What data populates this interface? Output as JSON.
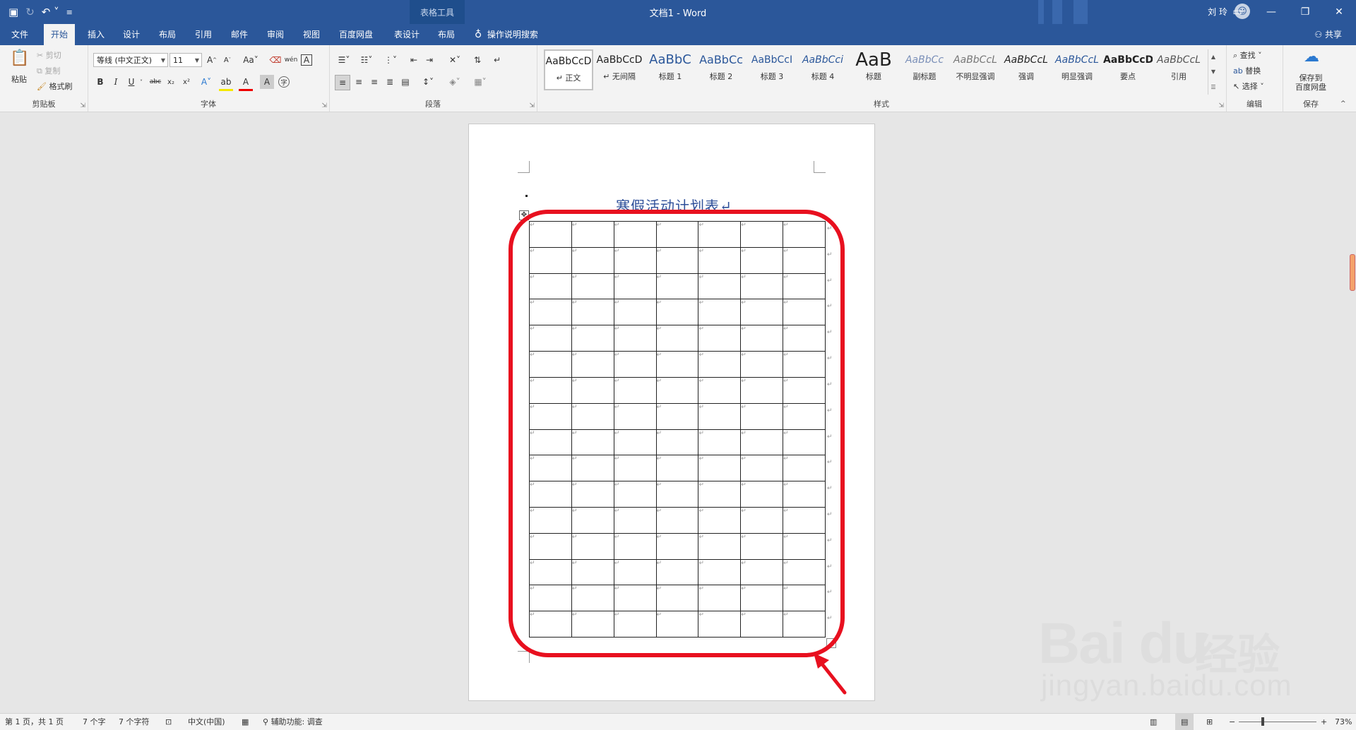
{
  "titlebar": {
    "doc_title": "文档1  -  Word",
    "context_tab": "表格工具",
    "user_name": "刘 玲",
    "qat": [
      "save-icon",
      "redo-icon",
      "undo-icon",
      "customize-icon"
    ]
  },
  "tabs": [
    {
      "label": "文件"
    },
    {
      "label": "开始"
    },
    {
      "label": "插入"
    },
    {
      "label": "设计"
    },
    {
      "label": "布局"
    },
    {
      "label": "引用"
    },
    {
      "label": "邮件"
    },
    {
      "label": "审阅"
    },
    {
      "label": "视图"
    },
    {
      "label": "百度网盘"
    },
    {
      "label": "表设计"
    },
    {
      "label": "布局"
    }
  ],
  "tell_me": "操作说明搜索",
  "share": "共享",
  "ribbon": {
    "clipboard": {
      "paste": "粘贴",
      "cut": "剪切",
      "copy": "复制",
      "format_painter": "格式刷",
      "label": "剪贴板"
    },
    "font": {
      "font_name": "等线 (中文正文)",
      "font_size": "11",
      "label": "字体"
    },
    "paragraph": {
      "label": "段落"
    },
    "styles": {
      "label": "样式",
      "items": [
        {
          "preview": "AaBbCcD",
          "name": "↵ 正文"
        },
        {
          "preview": "AaBbCcD",
          "name": "↵ 无间隔"
        },
        {
          "preview": "AaBbC",
          "name": "标题 1"
        },
        {
          "preview": "AaBbCc",
          "name": "标题 2"
        },
        {
          "preview": "AaBbCcI",
          "name": "标题 3"
        },
        {
          "preview": "AaBbCci",
          "name": "标题 4"
        },
        {
          "preview": "AaB",
          "name": "标题"
        },
        {
          "preview": "AaBbCc",
          "name": "副标题"
        },
        {
          "preview": "AaBbCcL",
          "name": "不明显强调"
        },
        {
          "preview": "AaBbCcL",
          "name": "强调"
        },
        {
          "preview": "AaBbCcL",
          "name": "明显强调"
        },
        {
          "preview": "AaBbCcD",
          "name": "要点"
        },
        {
          "preview": "AaBbCcL",
          "name": "引用"
        }
      ]
    },
    "editing": {
      "find": "查找",
      "replace": "替换",
      "select": "选择",
      "label": "编辑"
    },
    "save": {
      "line1": "保存到",
      "line2": "百度网盘",
      "label": "保存"
    }
  },
  "document": {
    "heading": "寒假活动计划表↵",
    "table_rows": 16,
    "table_cols": 7,
    "cell_mark": "↵"
  },
  "watermark": {
    "logo": "Bai du",
    "cn": "经验",
    "url": "jingyan.baidu.com"
  },
  "statusbar": {
    "page": "第 1 页，共 1 页",
    "words": "7 个字",
    "chars": "7 个字符",
    "language": "中文(中国)",
    "accessibility": "辅助功能: 调查",
    "zoom": "73%"
  },
  "colors": {
    "accent": "#2b579a",
    "highlight": "#e8101f"
  }
}
